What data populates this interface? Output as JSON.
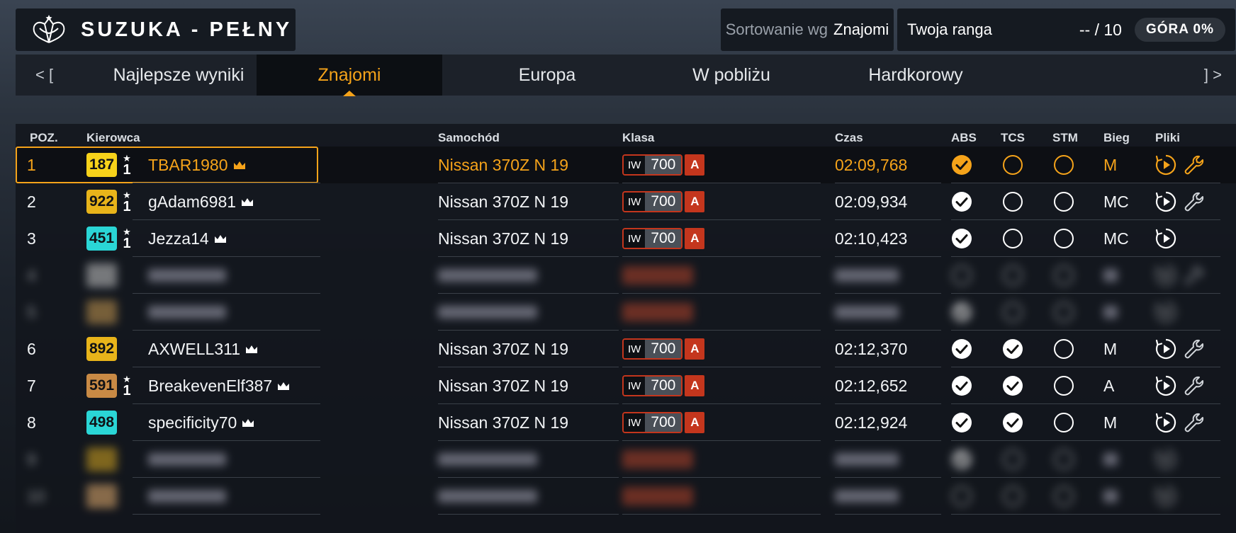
{
  "header": {
    "title": "SUZUKA - PEŁNY",
    "sort_label": "Sortowanie wg",
    "sort_value": "Znajomi",
    "rank_label": "Twoja ranga",
    "rank_value": "-- / 10",
    "top_label": "GÓRA 0%"
  },
  "tabs": {
    "left_arrow": "<  [",
    "right_arrow": "]  >",
    "items": [
      {
        "label": "Najlepsze wyniki"
      },
      {
        "label": "Znajomi"
      },
      {
        "label": "Europa"
      },
      {
        "label": "W pobliżu"
      },
      {
        "label": "Hardkorowy"
      }
    ]
  },
  "table": {
    "columns": {
      "pos": "POZ.",
      "driver": "Kierowca",
      "car": "Samochód",
      "class": "Klasa",
      "time": "Czas",
      "abs": "ABS",
      "tcs": "TCS",
      "stm": "STM",
      "gear": "Bieg",
      "files": "Pliki"
    },
    "rows": [
      {
        "pos": "1",
        "level": "187",
        "level_color": "#f7d21a",
        "star_rank": "1",
        "name": "TBAR1980",
        "car": "Nissan 370Z N 19",
        "iw": "IW",
        "pi": "700",
        "class_letter": "A",
        "time": "02:09,768",
        "abs": true,
        "tcs": false,
        "stm": false,
        "gear": "M",
        "replay": true,
        "tune": true,
        "highlight": true,
        "blurred": false
      },
      {
        "pos": "2",
        "level": "922",
        "level_color": "#e8b41a",
        "star_rank": "1",
        "name": "gAdam6981",
        "car": "Nissan 370Z N 19",
        "iw": "IW",
        "pi": "700",
        "class_letter": "A",
        "time": "02:09,934",
        "abs": true,
        "tcs": false,
        "stm": false,
        "gear": "MC",
        "replay": true,
        "tune": true,
        "highlight": false,
        "blurred": false
      },
      {
        "pos": "3",
        "level": "451",
        "level_color": "#2ad6d6",
        "star_rank": "1",
        "name": "Jezza14",
        "car": "Nissan 370Z N 19",
        "iw": "IW",
        "pi": "700",
        "class_letter": "A",
        "time": "02:10,423",
        "abs": true,
        "tcs": false,
        "stm": false,
        "gear": "MC",
        "replay": true,
        "tune": false,
        "highlight": false,
        "blurred": false
      },
      {
        "pos": "4",
        "level": "",
        "level_color": "#c8c8c8",
        "star_rank": "",
        "name": "",
        "car": "",
        "iw": "",
        "pi": "",
        "class_letter": "",
        "time": "",
        "abs": false,
        "tcs": false,
        "stm": false,
        "gear": "",
        "replay": true,
        "tune": true,
        "highlight": false,
        "blurred": true
      },
      {
        "pos": "5",
        "level": "",
        "level_color": "#c89a50",
        "star_rank": "",
        "name": "",
        "car": "",
        "iw": "",
        "pi": "",
        "class_letter": "",
        "time": "",
        "abs": true,
        "tcs": false,
        "stm": false,
        "gear": "",
        "replay": true,
        "tune": false,
        "highlight": false,
        "blurred": true
      },
      {
        "pos": "6",
        "level": "892",
        "level_color": "#e8b41a",
        "star_rank": "",
        "name": "AXWELL311",
        "car": "Nissan 370Z N 19",
        "iw": "IW",
        "pi": "700",
        "class_letter": "A",
        "time": "02:12,370",
        "abs": true,
        "tcs": true,
        "stm": false,
        "gear": "M",
        "replay": true,
        "tune": true,
        "highlight": false,
        "blurred": false
      },
      {
        "pos": "7",
        "level": "591",
        "level_color": "#c98a45",
        "star_rank": "1",
        "name": "BreakevenElf387",
        "car": "Nissan 370Z N 19",
        "iw": "IW",
        "pi": "700",
        "class_letter": "A",
        "time": "02:12,652",
        "abs": true,
        "tcs": true,
        "stm": false,
        "gear": "A",
        "replay": true,
        "tune": true,
        "highlight": false,
        "blurred": false
      },
      {
        "pos": "8",
        "level": "498",
        "level_color": "#2ad6d6",
        "star_rank": "",
        "name": "specificity70",
        "car": "Nissan 370Z N 19",
        "iw": "IW",
        "pi": "700",
        "class_letter": "A",
        "time": "02:12,924",
        "abs": true,
        "tcs": true,
        "stm": false,
        "gear": "M",
        "replay": true,
        "tune": true,
        "highlight": false,
        "blurred": false
      },
      {
        "pos": "9",
        "level": "",
        "level_color": "#d8a820",
        "star_rank": "",
        "name": "",
        "car": "",
        "iw": "",
        "pi": "",
        "class_letter": "",
        "time": "",
        "abs": true,
        "tcs": false,
        "stm": false,
        "gear": "",
        "replay": true,
        "tune": false,
        "highlight": false,
        "blurred": true
      },
      {
        "pos": "10",
        "level": "",
        "level_color": "#e8b070",
        "star_rank": "",
        "name": "",
        "car": "",
        "iw": "",
        "pi": "",
        "class_letter": "",
        "time": "",
        "abs": false,
        "tcs": false,
        "stm": false,
        "gear": "",
        "replay": true,
        "tune": false,
        "highlight": false,
        "blurred": true
      }
    ]
  },
  "colors": {
    "accent": "#f5a31a",
    "class_red": "#c4361d"
  },
  "icons": [
    "logo-icon",
    "crown-icon",
    "star-icon",
    "check-circle-icon",
    "empty-circle-icon",
    "replay-icon",
    "wrench-icon"
  ]
}
